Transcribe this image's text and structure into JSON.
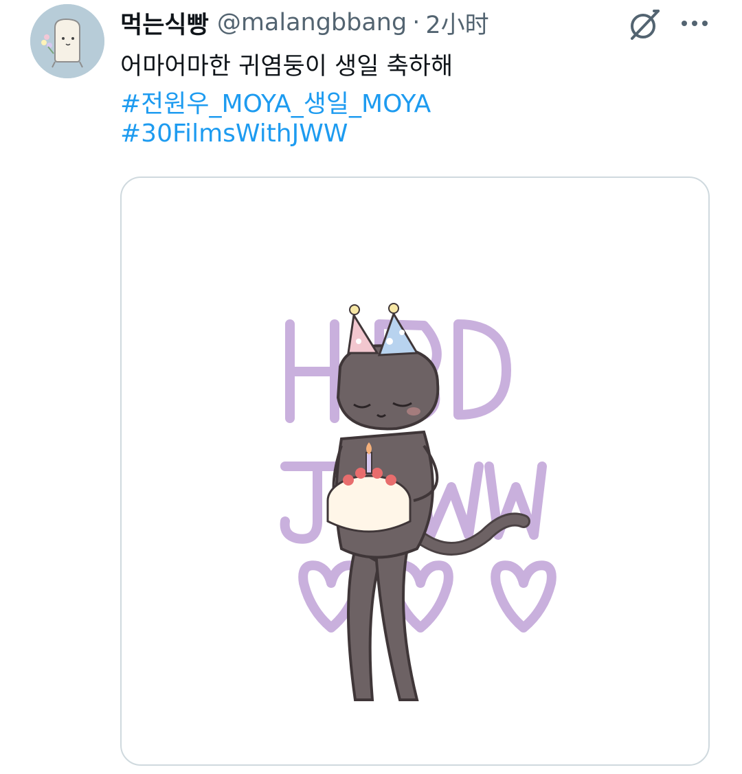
{
  "tweet": {
    "author": {
      "display_name": "먹는식빵",
      "handle": "@malangbbang"
    },
    "separator": "·",
    "time": "2小时",
    "text": "어마어마한 귀염둥이 생일 축하해",
    "hashtags": [
      "#전원우_MOYA_생일_MOYA",
      "#30FilmsWithJWW"
    ],
    "icons": {
      "grok": "grok-icon",
      "more": "more-options-icon",
      "avatar": "bread-character-avatar"
    },
    "media": {
      "illustration": "cat-with-party-hats-holding-birthday-cake",
      "lettering": "HBD JWW"
    }
  },
  "colors": {
    "link": "#1d9bf0",
    "secondary_text": "#536471",
    "primary_text": "#0f1419",
    "lettering": "#c9b0dd",
    "cat": "#6d6264"
  }
}
